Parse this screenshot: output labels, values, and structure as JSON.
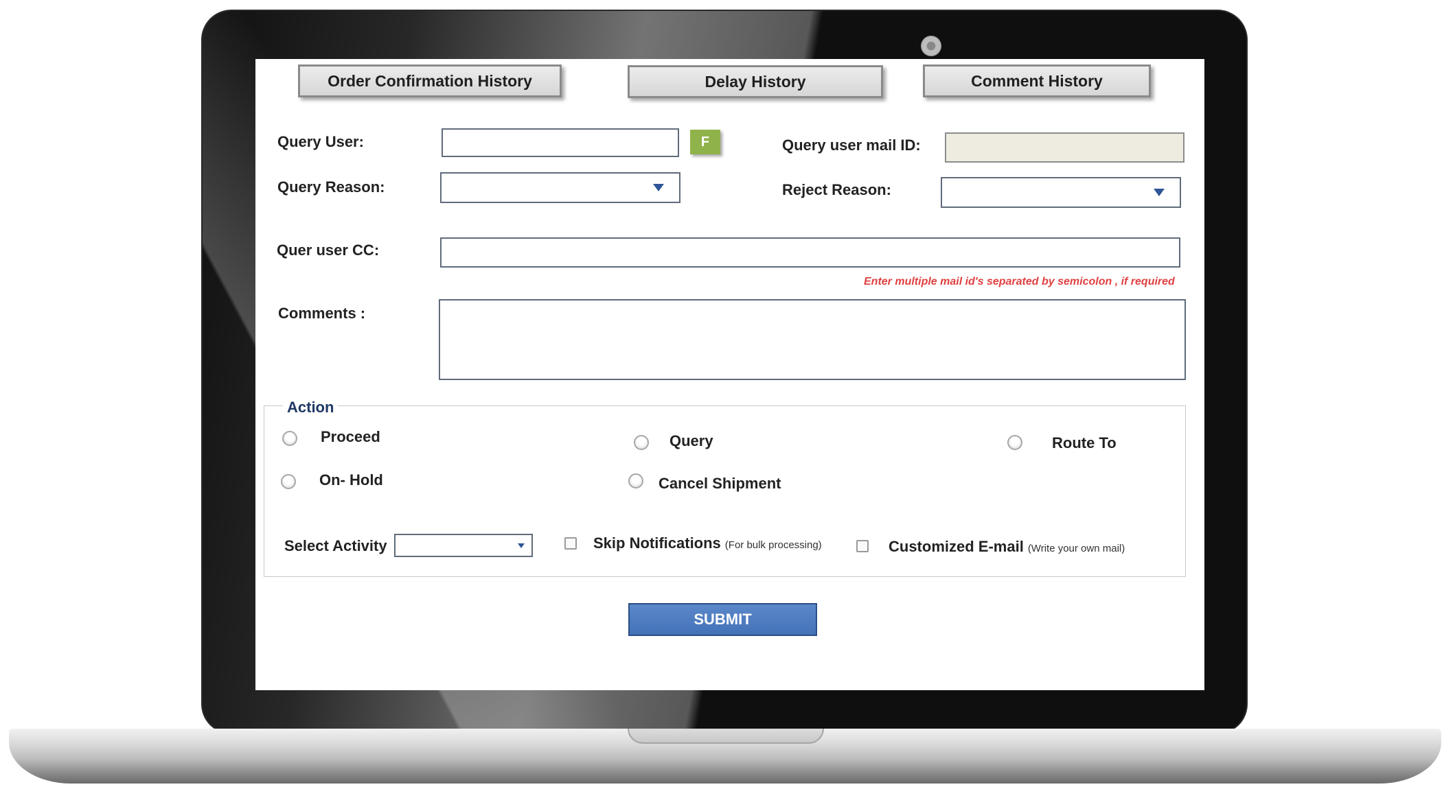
{
  "tabs": [
    {
      "label": "Order Confirmation History"
    },
    {
      "label": "Delay History"
    },
    {
      "label": "Comment History"
    }
  ],
  "form": {
    "query_user_label": "Query User:",
    "query_user_value": "",
    "f_button_label": "F",
    "query_user_mail_label": "Query user mail ID:",
    "query_user_mail_value": "",
    "query_reason_label": "Query Reason:",
    "query_reason_value": "",
    "reject_reason_label": "Reject  Reason:",
    "reject_reason_value": "",
    "cc_label": "Quer user CC:",
    "cc_value": "",
    "cc_hint": "Enter multiple mail id's separated by semicolon , if required",
    "comments_label": "Comments :",
    "comments_value": ""
  },
  "action": {
    "legend": "Action",
    "options": [
      {
        "label": "Proceed",
        "checked": false
      },
      {
        "label": "Query",
        "checked": false
      },
      {
        "label": "Route To",
        "checked": false
      },
      {
        "label": "On- Hold",
        "checked": false
      },
      {
        "label": "Cancel Shipment",
        "checked": false
      }
    ],
    "select_activity_label": "Select Activity",
    "select_activity_value": "",
    "skip_notifications_label": "Skip Notifications",
    "skip_notifications_note": "(For bulk processing)",
    "skip_notifications_checked": false,
    "custom_email_label": "Customized E-mail",
    "custom_email_note": "(Write your own mail)",
    "custom_email_checked": false
  },
  "submit_label": "SUBMIT",
  "colors": {
    "accent_blue": "#4472b8",
    "f_button_green": "#8fb34a",
    "hint_red": "#e04040",
    "legend_navy": "#1f3864",
    "readonly_field": "#eeebe0"
  }
}
